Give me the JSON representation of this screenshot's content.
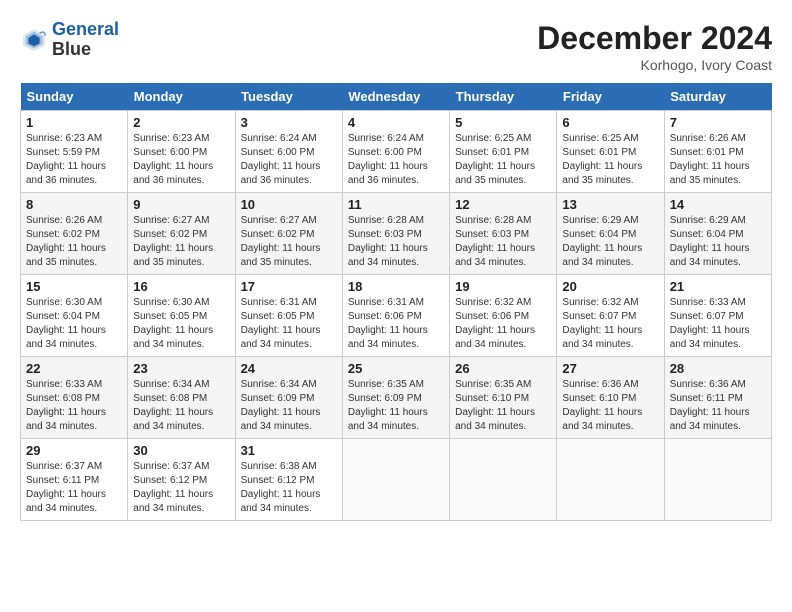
{
  "header": {
    "logo_line1": "General",
    "logo_line2": "Blue",
    "month_year": "December 2024",
    "location": "Korhogo, Ivory Coast"
  },
  "weekdays": [
    "Sunday",
    "Monday",
    "Tuesday",
    "Wednesday",
    "Thursday",
    "Friday",
    "Saturday"
  ],
  "weeks": [
    [
      {
        "day": "1",
        "info": "Sunrise: 6:23 AM\nSunset: 5:59 PM\nDaylight: 11 hours\nand 36 minutes."
      },
      {
        "day": "2",
        "info": "Sunrise: 6:23 AM\nSunset: 6:00 PM\nDaylight: 11 hours\nand 36 minutes."
      },
      {
        "day": "3",
        "info": "Sunrise: 6:24 AM\nSunset: 6:00 PM\nDaylight: 11 hours\nand 36 minutes."
      },
      {
        "day": "4",
        "info": "Sunrise: 6:24 AM\nSunset: 6:00 PM\nDaylight: 11 hours\nand 36 minutes."
      },
      {
        "day": "5",
        "info": "Sunrise: 6:25 AM\nSunset: 6:01 PM\nDaylight: 11 hours\nand 35 minutes."
      },
      {
        "day": "6",
        "info": "Sunrise: 6:25 AM\nSunset: 6:01 PM\nDaylight: 11 hours\nand 35 minutes."
      },
      {
        "day": "7",
        "info": "Sunrise: 6:26 AM\nSunset: 6:01 PM\nDaylight: 11 hours\nand 35 minutes."
      }
    ],
    [
      {
        "day": "8",
        "info": "Sunrise: 6:26 AM\nSunset: 6:02 PM\nDaylight: 11 hours\nand 35 minutes."
      },
      {
        "day": "9",
        "info": "Sunrise: 6:27 AM\nSunset: 6:02 PM\nDaylight: 11 hours\nand 35 minutes."
      },
      {
        "day": "10",
        "info": "Sunrise: 6:27 AM\nSunset: 6:02 PM\nDaylight: 11 hours\nand 35 minutes."
      },
      {
        "day": "11",
        "info": "Sunrise: 6:28 AM\nSunset: 6:03 PM\nDaylight: 11 hours\nand 34 minutes."
      },
      {
        "day": "12",
        "info": "Sunrise: 6:28 AM\nSunset: 6:03 PM\nDaylight: 11 hours\nand 34 minutes."
      },
      {
        "day": "13",
        "info": "Sunrise: 6:29 AM\nSunset: 6:04 PM\nDaylight: 11 hours\nand 34 minutes."
      },
      {
        "day": "14",
        "info": "Sunrise: 6:29 AM\nSunset: 6:04 PM\nDaylight: 11 hours\nand 34 minutes."
      }
    ],
    [
      {
        "day": "15",
        "info": "Sunrise: 6:30 AM\nSunset: 6:04 PM\nDaylight: 11 hours\nand 34 minutes."
      },
      {
        "day": "16",
        "info": "Sunrise: 6:30 AM\nSunset: 6:05 PM\nDaylight: 11 hours\nand 34 minutes."
      },
      {
        "day": "17",
        "info": "Sunrise: 6:31 AM\nSunset: 6:05 PM\nDaylight: 11 hours\nand 34 minutes."
      },
      {
        "day": "18",
        "info": "Sunrise: 6:31 AM\nSunset: 6:06 PM\nDaylight: 11 hours\nand 34 minutes."
      },
      {
        "day": "19",
        "info": "Sunrise: 6:32 AM\nSunset: 6:06 PM\nDaylight: 11 hours\nand 34 minutes."
      },
      {
        "day": "20",
        "info": "Sunrise: 6:32 AM\nSunset: 6:07 PM\nDaylight: 11 hours\nand 34 minutes."
      },
      {
        "day": "21",
        "info": "Sunrise: 6:33 AM\nSunset: 6:07 PM\nDaylight: 11 hours\nand 34 minutes."
      }
    ],
    [
      {
        "day": "22",
        "info": "Sunrise: 6:33 AM\nSunset: 6:08 PM\nDaylight: 11 hours\nand 34 minutes."
      },
      {
        "day": "23",
        "info": "Sunrise: 6:34 AM\nSunset: 6:08 PM\nDaylight: 11 hours\nand 34 minutes."
      },
      {
        "day": "24",
        "info": "Sunrise: 6:34 AM\nSunset: 6:09 PM\nDaylight: 11 hours\nand 34 minutes."
      },
      {
        "day": "25",
        "info": "Sunrise: 6:35 AM\nSunset: 6:09 PM\nDaylight: 11 hours\nand 34 minutes."
      },
      {
        "day": "26",
        "info": "Sunrise: 6:35 AM\nSunset: 6:10 PM\nDaylight: 11 hours\nand 34 minutes."
      },
      {
        "day": "27",
        "info": "Sunrise: 6:36 AM\nSunset: 6:10 PM\nDaylight: 11 hours\nand 34 minutes."
      },
      {
        "day": "28",
        "info": "Sunrise: 6:36 AM\nSunset: 6:11 PM\nDaylight: 11 hours\nand 34 minutes."
      }
    ],
    [
      {
        "day": "29",
        "info": "Sunrise: 6:37 AM\nSunset: 6:11 PM\nDaylight: 11 hours\nand 34 minutes."
      },
      {
        "day": "30",
        "info": "Sunrise: 6:37 AM\nSunset: 6:12 PM\nDaylight: 11 hours\nand 34 minutes."
      },
      {
        "day": "31",
        "info": "Sunrise: 6:38 AM\nSunset: 6:12 PM\nDaylight: 11 hours\nand 34 minutes."
      },
      {
        "day": "",
        "info": ""
      },
      {
        "day": "",
        "info": ""
      },
      {
        "day": "",
        "info": ""
      },
      {
        "day": "",
        "info": ""
      }
    ]
  ]
}
